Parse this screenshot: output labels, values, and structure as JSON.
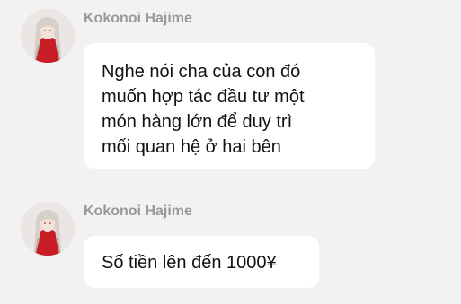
{
  "messages": [
    {
      "sender": "Kokonoi Hajime",
      "lines": [
        "Nghe nói cha của con đó",
        "muốn hợp tác đầu tư một",
        "món hàng lớn để duy trì",
        "mối quan hệ ở hai bên"
      ]
    },
    {
      "sender": "Kokonoi Hajime",
      "lines": [
        "Số tiền lên đến 1000¥"
      ]
    }
  ],
  "colors": {
    "background": "#f2f2f2",
    "bubble": "#ffffff",
    "sender_name": "#999999",
    "text": "#111111"
  },
  "avatar_icon": "character-portrait-icon"
}
